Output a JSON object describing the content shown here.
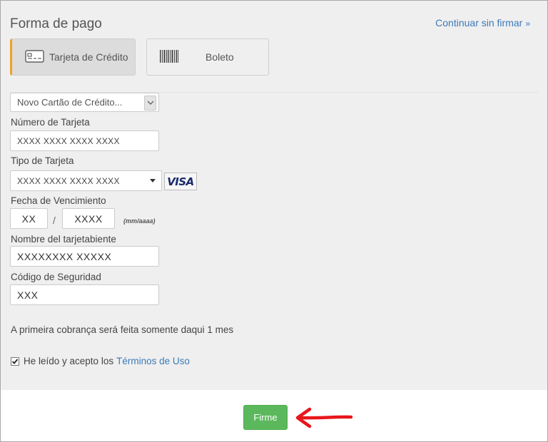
{
  "header": {
    "title": "Forma de pago",
    "continue_link": "Continuar sin firmar",
    "continue_chevron": "»"
  },
  "payment_methods": [
    {
      "label": "Tarjeta de Crédito",
      "icon": "credit-card-icon",
      "selected": true
    },
    {
      "label": "Boleto",
      "icon": "barcode-icon",
      "selected": false
    }
  ],
  "form": {
    "card_select": {
      "value": "Novo Cartão de Crédito..."
    },
    "card_number": {
      "label": "Número de Tarjeta",
      "value": "XXXX XXXX XXXX XXXX"
    },
    "card_type": {
      "label": "Tipo de Tarjeta",
      "value": "XXXX XXXX XXXX XXXX",
      "brand": "VISA"
    },
    "expiration": {
      "label": "Fecha de Vencimiento",
      "month": "XX",
      "separator": "/",
      "year": "XXXX",
      "hint": "(mm/aaaa)"
    },
    "holder_name": {
      "label": "Nombre del tarjetabiente",
      "value": "XXXXXXXX XXXXX"
    },
    "security_code": {
      "label": "Código de Seguridad",
      "value": "XXX"
    }
  },
  "notice": "A primeira cobrança será feita somente daqui 1 mes",
  "terms": {
    "checked": true,
    "text": "He leído y acepto los",
    "link": "Términos de Uso"
  },
  "footer": {
    "sign_button": "Firme"
  },
  "colors": {
    "accent": "#f0a125",
    "link": "#3c7ab8",
    "button": "#5cb85c",
    "arrow": "#e8161b"
  }
}
